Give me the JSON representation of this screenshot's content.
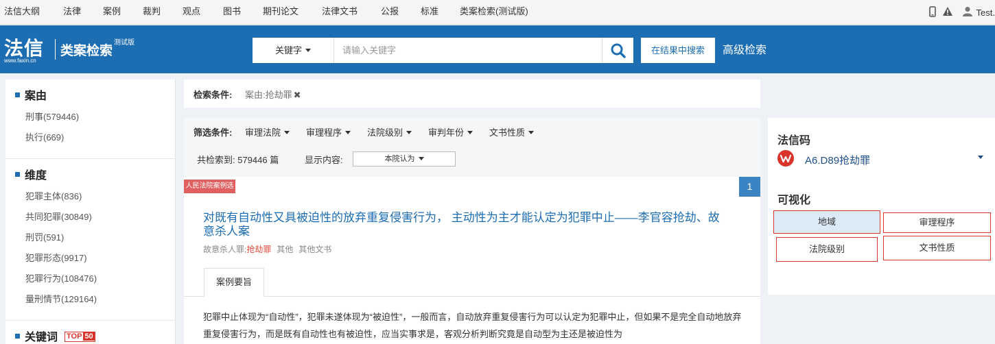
{
  "topnav": {
    "items": [
      "法信大纲",
      "法律",
      "案例",
      "裁判",
      "观点",
      "图书",
      "期刊论文",
      "法律文书",
      "公报",
      "标准",
      "类案检索(测试版)"
    ],
    "user": "Test."
  },
  "header": {
    "logo_main": "法信",
    "logo_url": "www.faxin.cn",
    "logo_sub": "类案检索",
    "logo_beta": "测试版",
    "search_type": "关键字",
    "search_placeholder": "请输入关键字",
    "within_results": "在结果中搜索",
    "advanced": "高级检索"
  },
  "sidebar": {
    "sections": [
      {
        "title": "案由",
        "items": [
          "刑事(579446)",
          "执行(669)"
        ]
      },
      {
        "title": "维度",
        "items": [
          "犯罪主体(836)",
          "共同犯罪(30849)",
          "刑罚(591)",
          "犯罪形态(9917)",
          "犯罪行为(108476)",
          "量刑情节(129164)"
        ]
      },
      {
        "title": "关键词",
        "badge_a": "TOP",
        "badge_b": "50"
      }
    ]
  },
  "conditions": {
    "label": "检索条件:",
    "tag": "案由:抢劫罪",
    "remove": "✖"
  },
  "filter": {
    "label": "筛选条件:",
    "items": [
      "审理法院",
      "审理程序",
      "法院级别",
      "审判年份",
      "文书性质"
    ]
  },
  "results_bar": {
    "count": "共检索到:  579446 篇",
    "show_label": "显示内容:",
    "show_value": "本院认为"
  },
  "result": {
    "badge": "人民法院案例选",
    "page": "1",
    "title": "对既有自动性又具被迫性的放弃重复侵害行为， 主动性为主才能认定为犯罪中止——李官容抢劫、故意杀人案",
    "meta_prefix": "故意杀人罪;",
    "meta_highlight": "抢劫罪",
    "meta_tag1": "其他",
    "meta_tag2": "其他文书",
    "tab": "案例要旨",
    "body": "犯罪中止体现为“自动性”，犯罪未遂体现为“被迫性”，一般而言，自动放弃重复侵害行为可以认定为犯罪中止，但如果不是完全自动地放弃重复侵害行为，而是既有自动性也有被迫性，应当实事求是，客观分析判断究竟是自动型为主还是被迫性为"
  },
  "right_panel": {
    "code_title": "法信码",
    "code_value": "A6.D89抢劫罪",
    "viz_title": "可视化",
    "viz_buttons": [
      "地域",
      "审理程序",
      "法院级别",
      "文书性质"
    ]
  },
  "colors": {
    "brand_blue": "#1d6db3",
    "accent_red": "#d9342b",
    "badge_red": "#e06060"
  }
}
